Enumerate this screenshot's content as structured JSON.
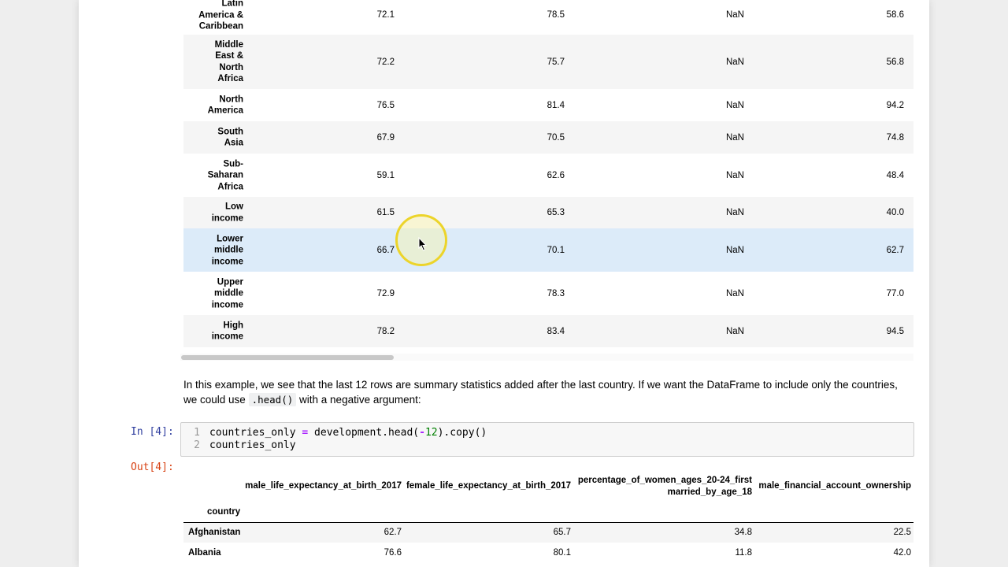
{
  "upper_table": {
    "rows": [
      {
        "index": "Latin\nAmerica &\nCaribbean",
        "values": [
          "72.1",
          "78.5",
          "NaN",
          "58.6"
        ]
      },
      {
        "index": "Middle\nEast &\nNorth\nAfrica",
        "values": [
          "72.2",
          "75.7",
          "NaN",
          "56.8"
        ]
      },
      {
        "index": "North\nAmerica",
        "values": [
          "76.5",
          "81.4",
          "NaN",
          "94.2"
        ]
      },
      {
        "index": "South\nAsia",
        "values": [
          "67.9",
          "70.5",
          "NaN",
          "74.8"
        ]
      },
      {
        "index": "Sub-\nSaharan\nAfrica",
        "values": [
          "59.1",
          "62.6",
          "NaN",
          "48.4"
        ]
      },
      {
        "index": "Low\nincome",
        "values": [
          "61.5",
          "65.3",
          "NaN",
          "40.0"
        ]
      },
      {
        "index": "Lower\nmiddle\nincome",
        "values": [
          "66.7",
          "70.1",
          "NaN",
          "62.7"
        ]
      },
      {
        "index": "Upper\nmiddle\nincome",
        "values": [
          "72.9",
          "78.3",
          "NaN",
          "77.0"
        ]
      },
      {
        "index": "High\nincome",
        "values": [
          "78.2",
          "83.4",
          "NaN",
          "94.5"
        ]
      }
    ]
  },
  "markdown": {
    "line1": "In this example, we see that the last 12 rows are summary statistics added after the last country. If we want the DataFrame to include only the countries,",
    "line2_pre": "we could use",
    "line2_code": ".head()",
    "line2_post": "with a negative argument:"
  },
  "in_prompt": "In [4]:",
  "out_prompt": "Out[4]:",
  "code": {
    "line_numbers": [
      "1",
      "2"
    ],
    "line1_a": "countries_only ",
    "line1_op": "=",
    "line1_b": " development.head(",
    "line1_neg": "-",
    "line1_num": "12",
    "line1_c": ").copy()",
    "line2": "countries_only"
  },
  "lower_table": {
    "columns": [
      "male_life_expectancy_at_birth_2017",
      "female_life_expectancy_at_birth_2017",
      "percentage_of_women_ages_20-24_first\nmarried_by_age_18",
      "male_financial_account_ownership"
    ],
    "index_name": "country",
    "rows": [
      {
        "index": "Afghanistan",
        "values": [
          "62.7",
          "65.7",
          "34.8",
          "22.5"
        ]
      },
      {
        "index": "Albania",
        "values": [
          "76.6",
          "80.1",
          "11.8",
          "42.0"
        ]
      }
    ]
  },
  "colors": {
    "highlight_row": "#dcebf9",
    "in_prompt": "#303f9f",
    "out_prompt": "#d84315",
    "cursor_halo": "#ecd42a"
  },
  "icons": {
    "cursor": "mouse-pointer-icon"
  }
}
